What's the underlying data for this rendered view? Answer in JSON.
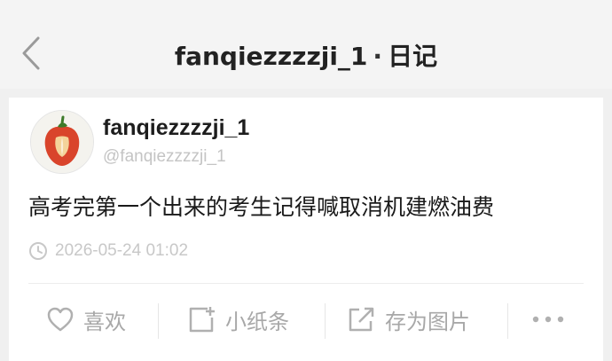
{
  "nav": {
    "title_name": "fanqiezzzzji_1",
    "title_sep": "·",
    "title_section": "日记"
  },
  "post": {
    "username": "fanqiezzzzji_1",
    "handle": "@fanqiezzzzji_1",
    "text": "高考完第一个出来的考生记得喊取消机建燃油费",
    "timestamp": "2026-05-24 01:02"
  },
  "actions": {
    "like": "喜欢",
    "note": "小纸条",
    "save_image": "存为图片",
    "more_icon": "more-dots-icon"
  },
  "icons": {
    "back": "chevron-left-icon",
    "clock": "clock-icon",
    "heart": "heart-icon",
    "note": "note-add-icon",
    "share": "share-icon",
    "avatar": "pepper-avatar"
  },
  "colors": {
    "text_primary": "#1d1d1d",
    "text_muted": "#a8a8a8",
    "avatar_pepper": "#d9442b"
  }
}
